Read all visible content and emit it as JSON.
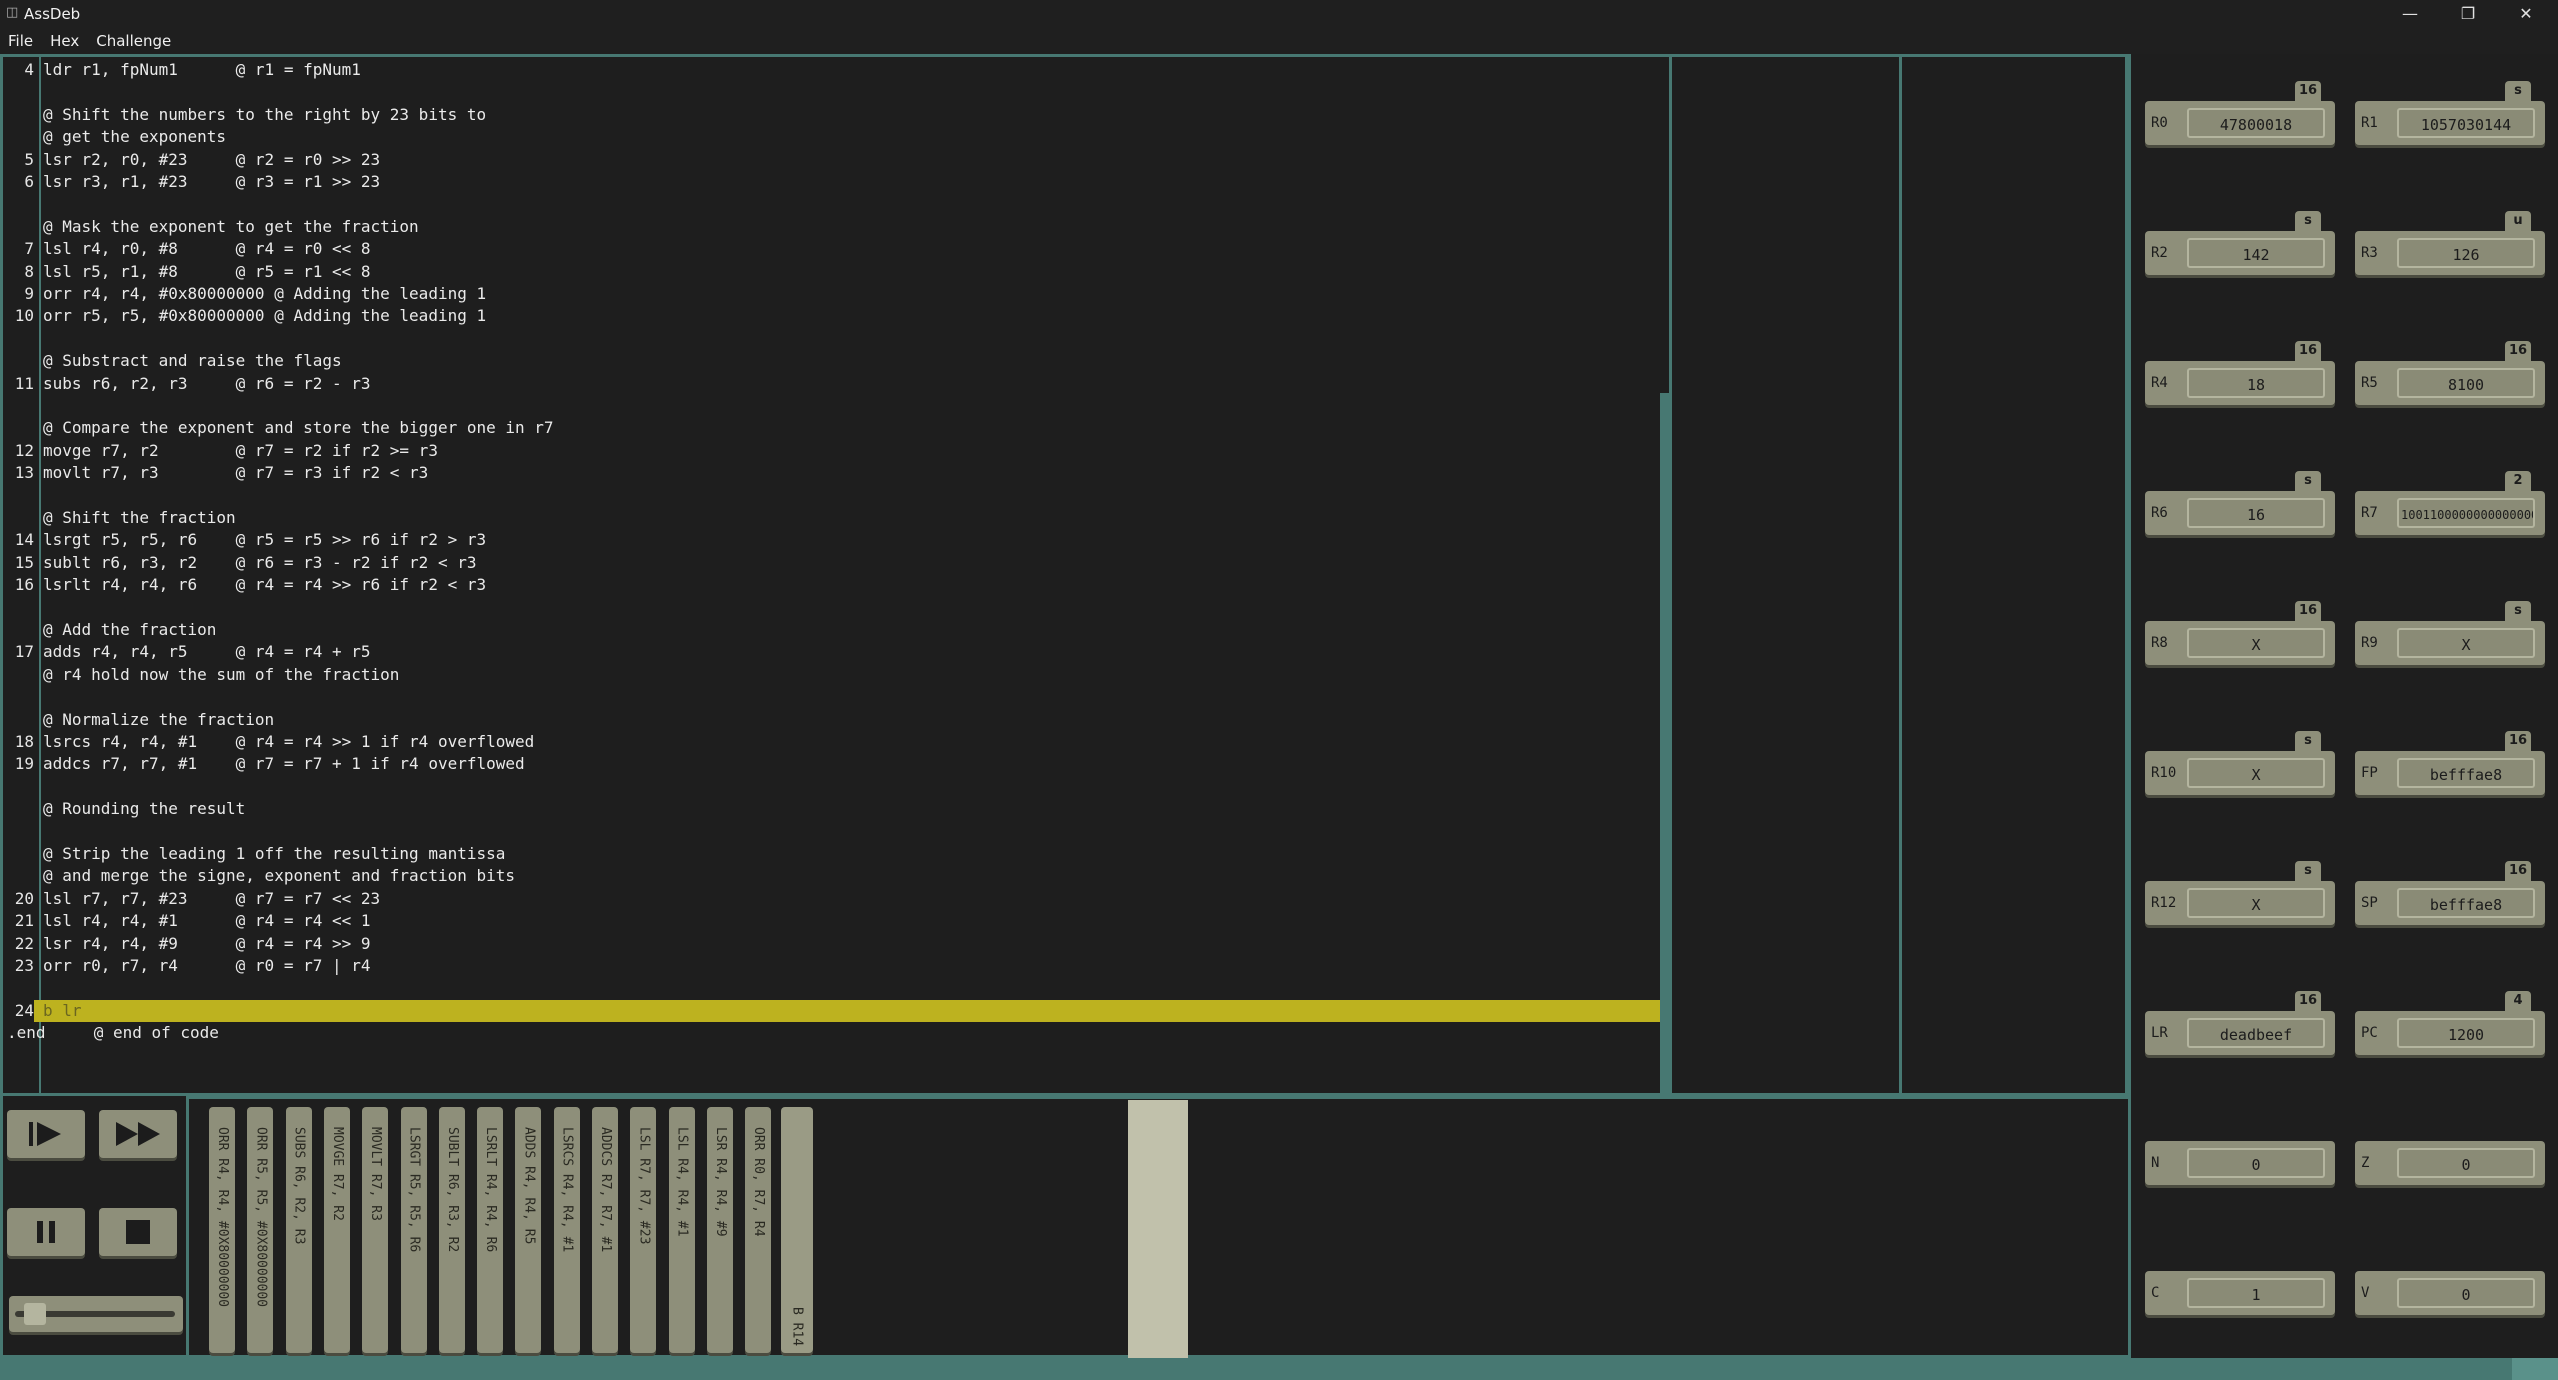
{
  "window": {
    "title": "AssDeb",
    "icon": "app-icon",
    "minimize_icon": "—",
    "restore_icon": "❐",
    "close_icon": "✕"
  },
  "menu": [
    "File",
    "Hex",
    "Challenge"
  ],
  "editor": {
    "active_line": 24,
    "lines": [
      {
        "n": "4",
        "code": "ldr r1, fpNum1      @ r1 = fpNum1"
      },
      {
        "n": "",
        "code": ""
      },
      {
        "n": "",
        "code": "@ Shift the numbers to the right by 23 bits to"
      },
      {
        "n": "",
        "code": "@ get the exponents"
      },
      {
        "n": "5",
        "code": "lsr r2, r0, #23     @ r2 = r0 >> 23"
      },
      {
        "n": "6",
        "code": "lsr r3, r1, #23     @ r3 = r1 >> 23"
      },
      {
        "n": "",
        "code": ""
      },
      {
        "n": "",
        "code": "@ Mask the exponent to get the fraction"
      },
      {
        "n": "7",
        "code": "lsl r4, r0, #8      @ r4 = r0 << 8"
      },
      {
        "n": "8",
        "code": "lsl r5, r1, #8      @ r5 = r1 << 8"
      },
      {
        "n": "9",
        "code": "orr r4, r4, #0x80000000 @ Adding the leading 1"
      },
      {
        "n": "10",
        "code": "orr r5, r5, #0x80000000 @ Adding the leading 1"
      },
      {
        "n": "",
        "code": ""
      },
      {
        "n": "",
        "code": "@ Substract and raise the flags"
      },
      {
        "n": "11",
        "code": "subs r6, r2, r3     @ r6 = r2 - r3"
      },
      {
        "n": "",
        "code": ""
      },
      {
        "n": "",
        "code": "@ Compare the exponent and store the bigger one in r7"
      },
      {
        "n": "12",
        "code": "movge r7, r2        @ r7 = r2 if r2 >= r3"
      },
      {
        "n": "13",
        "code": "movlt r7, r3        @ r7 = r3 if r2 < r3"
      },
      {
        "n": "",
        "code": ""
      },
      {
        "n": "",
        "code": "@ Shift the fraction"
      },
      {
        "n": "14",
        "code": "lsrgt r5, r5, r6    @ r5 = r5 >> r6 if r2 > r3"
      },
      {
        "n": "15",
        "code": "sublt r6, r3, r2    @ r6 = r3 - r2 if r2 < r3"
      },
      {
        "n": "16",
        "code": "lsrlt r4, r4, r6    @ r4 = r4 >> r6 if r2 < r3"
      },
      {
        "n": "",
        "code": ""
      },
      {
        "n": "",
        "code": "@ Add the fraction"
      },
      {
        "n": "17",
        "code": "adds r4, r4, r5     @ r4 = r4 + r5"
      },
      {
        "n": "",
        "code": "@ r4 hold now the sum of the fraction"
      },
      {
        "n": "",
        "code": ""
      },
      {
        "n": "",
        "code": "@ Normalize the fraction"
      },
      {
        "n": "18",
        "code": "lsrcs r4, r4, #1    @ r4 = r4 >> 1 if r4 overflowed"
      },
      {
        "n": "19",
        "code": "addcs r7, r7, #1    @ r7 = r7 + 1 if r4 overflowed"
      },
      {
        "n": "",
        "code": ""
      },
      {
        "n": "",
        "code": "@ Rounding the result"
      },
      {
        "n": "",
        "code": ""
      },
      {
        "n": "",
        "code": "@ Strip the leading 1 off the resulting mantissa"
      },
      {
        "n": "",
        "code": "@ and merge the signe, exponent and fraction bits"
      },
      {
        "n": "20",
        "code": "lsl r7, r7, #23     @ r7 = r7 << 23"
      },
      {
        "n": "21",
        "code": "lsl r4, r4, #1      @ r4 = r4 << 1"
      },
      {
        "n": "22",
        "code": "lsr r4, r4, #9      @ r4 = r4 >> 9"
      },
      {
        "n": "23",
        "code": "orr r0, r7, r4      @ r0 = r7 | r4"
      },
      {
        "n": "",
        "code": ""
      },
      {
        "n": "24",
        "code": "b lr"
      },
      {
        "n": "",
        "code": ".end     @ end of code"
      }
    ]
  },
  "registers": [
    {
      "name": "R0",
      "value": "47800018",
      "base": "16"
    },
    {
      "name": "R1",
      "value": "1057030144",
      "base": "s"
    },
    {
      "name": "R2",
      "value": "142",
      "base": "s"
    },
    {
      "name": "R3",
      "value": "126",
      "base": "u"
    },
    {
      "name": "R4",
      "value": "18",
      "base": "16"
    },
    {
      "name": "R5",
      "value": "8100",
      "base": "16"
    },
    {
      "name": "R6",
      "value": "16",
      "base": "s"
    },
    {
      "name": "R7",
      "value": "10011000000000000000",
      "base": "2"
    },
    {
      "name": "R8",
      "value": "X",
      "base": "16"
    },
    {
      "name": "R9",
      "value": "X",
      "base": "s"
    },
    {
      "name": "R10",
      "value": "X",
      "base": "s"
    },
    {
      "name": "FP",
      "value": "befffae8",
      "base": "16"
    },
    {
      "name": "R12",
      "value": "X",
      "base": "s"
    },
    {
      "name": "SP",
      "value": "befffae8",
      "base": "16"
    },
    {
      "name": "LR",
      "value": "deadbeef",
      "base": "16"
    },
    {
      "name": "PC",
      "value": "1200",
      "base": "4"
    },
    {
      "name": "N",
      "value": "0",
      "base": ""
    },
    {
      "name": "Z",
      "value": "0",
      "base": ""
    },
    {
      "name": "C",
      "value": "1",
      "base": ""
    },
    {
      "name": "V",
      "value": "0",
      "base": ""
    }
  ],
  "controls": {
    "step_icon": "step-play-icon",
    "run_icon": "fast-forward-icon",
    "pause_icon": "pause-icon",
    "stop_icon": "stop-icon",
    "speed_level": 0.05
  },
  "pipeline": [
    "ORR R4, R4, #0X80000000",
    "ORR R5, R5, #0X80000000",
    "SUBS R6, R2, R3",
    "MOVGE R7, R2",
    "MOVLT R7, R3",
    "LSRGT R5, R5, R6",
    "SUBLT R6, R3, R2",
    "LSRLT R4, R4, R6",
    "ADDS R4, R4, R5",
    "LSRCS R4, R4, #1",
    "ADDCS R7, R7, #1",
    "LSL R7, R7, #23",
    "LSL R4, R4, #1",
    "LSR R4, R4, #9",
    "ORR R0, R7, R4",
    "B R14"
  ],
  "colors": {
    "accent": "#477872",
    "widget": "#8e8f7a",
    "highlight": "#bdb21f",
    "background": "#1e1e1e"
  }
}
